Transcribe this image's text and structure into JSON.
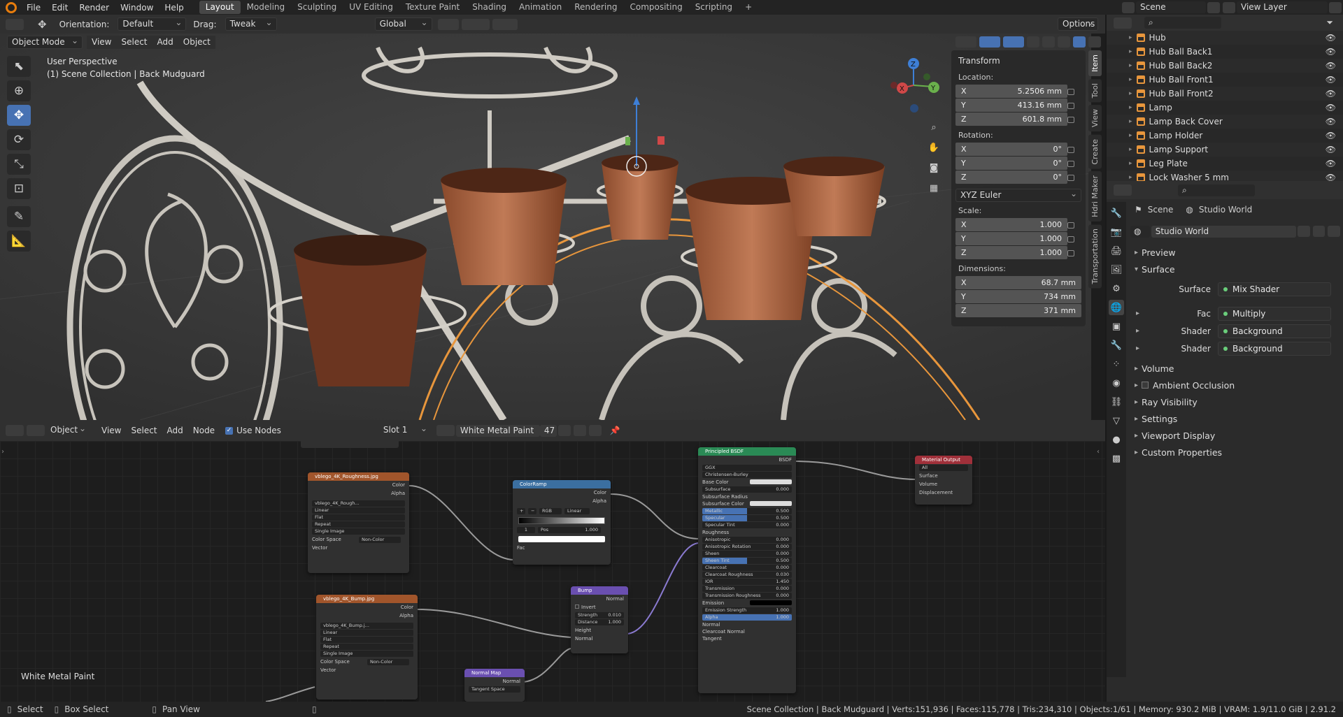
{
  "menubar": {
    "items": [
      "File",
      "Edit",
      "Render",
      "Window",
      "Help"
    ],
    "workspaces": [
      "Layout",
      "Modeling",
      "Sculpting",
      "UV Editing",
      "Texture Paint",
      "Shading",
      "Animation",
      "Rendering",
      "Compositing",
      "Scripting"
    ],
    "active_workspace": "Layout",
    "add_tab": "+",
    "scene": "Scene",
    "view_layer": "View Layer"
  },
  "viewport_header": {
    "orientation_label": "Orientation:",
    "orientation_value": "Default",
    "drag_label": "Drag:",
    "drag_value": "Tweak",
    "transform_orientation": "Global",
    "options": "Options"
  },
  "viewport_header2": {
    "mode": "Object Mode",
    "menus": [
      "View",
      "Select",
      "Add",
      "Object"
    ]
  },
  "viewport": {
    "perspective": "User Perspective",
    "collection": "(1) Scene Collection | Back Mudguard"
  },
  "n_panel": {
    "title": "Transform",
    "location_label": "Location:",
    "location": [
      {
        "axis": "X",
        "value": "5.2506 mm"
      },
      {
        "axis": "Y",
        "value": "413.16 mm"
      },
      {
        "axis": "Z",
        "value": "601.8 mm"
      }
    ],
    "rotation_label": "Rotation:",
    "rotation": [
      {
        "axis": "X",
        "value": "0°"
      },
      {
        "axis": "Y",
        "value": "0°"
      },
      {
        "axis": "Z",
        "value": "0°"
      }
    ],
    "rotation_mode": "XYZ Euler",
    "scale_label": "Scale:",
    "scale": [
      {
        "axis": "X",
        "value": "1.000"
      },
      {
        "axis": "Y",
        "value": "1.000"
      },
      {
        "axis": "Z",
        "value": "1.000"
      }
    ],
    "dimensions_label": "Dimensions:",
    "dimensions": [
      {
        "axis": "X",
        "value": "68.7 mm"
      },
      {
        "axis": "Y",
        "value": "734 mm"
      },
      {
        "axis": "Z",
        "value": "371 mm"
      }
    ],
    "tabs": [
      "Item",
      "Tool",
      "View",
      "Create",
      "Hdri Maker",
      "Transportation"
    ]
  },
  "outliner": {
    "items": [
      "Hub",
      "Hub Ball Back1",
      "Hub Ball Back2",
      "Hub Ball Front1",
      "Hub Ball Front2",
      "Lamp",
      "Lamp Back Cover",
      "Lamp Holder",
      "Lamp Support",
      "Leg Plate",
      "Lock Washer 5 mm"
    ]
  },
  "properties": {
    "breadcrumb_scene": "Scene",
    "breadcrumb_world": "Studio World",
    "world_name": "Studio World",
    "sections": {
      "preview": "Preview",
      "surface": "Surface",
      "volume": "Volume",
      "ao": "Ambient Occlusion",
      "ray": "Ray Visibility",
      "settings": "Settings",
      "viewport_display": "Viewport Display",
      "custom": "Custom Properties"
    },
    "surface_rows": [
      {
        "label": "Surface",
        "value": "Mix Shader"
      },
      {
        "label": "Fac",
        "value": "Multiply"
      },
      {
        "label": "Shader",
        "value": "Background"
      },
      {
        "label": "Shader",
        "value": "Background"
      }
    ]
  },
  "node_header": {
    "type": "Object",
    "menus": [
      "View",
      "Select",
      "Add",
      "Node"
    ],
    "use_nodes": "Use Nodes",
    "slot": "Slot 1",
    "material": "White Metal Paint",
    "users": "47"
  },
  "node_editor": {
    "material_label": "White Metal Paint",
    "nodes": {
      "roughness_tex": {
        "title": "vblego_4K_Roughness.jpg",
        "out1": "Color",
        "out2": "Alpha",
        "image": "vblego_4K_Rough...",
        "interp": "Linear",
        "proj": "Flat",
        "ext": "Repeat",
        "src": "Single Image",
        "cs_label": "Color Space",
        "cs": "Non-Color",
        "vec": "Vector"
      },
      "bump_tex": {
        "title": "vblego_4K_Bump.jpg",
        "out1": "Color",
        "out2": "Alpha",
        "image": "vblego_4K_Bump.j...",
        "interp": "Linear",
        "proj": "Flat",
        "ext": "Repeat",
        "src": "Single Image",
        "cs_label": "Color Space",
        "cs": "Non-Color",
        "vec": "Vector"
      },
      "colorramp": {
        "title": "ColorRamp",
        "out1": "Color",
        "out2": "Alpha",
        "mode": "RGB",
        "interp": "Linear",
        "stop": "1",
        "pos_label": "Pos",
        "pos": "1.000",
        "fac": "Fac"
      },
      "bump": {
        "title": "Bump",
        "out": "Normal",
        "invert": "Invert",
        "strength_label": "Strength",
        "strength": "0.010",
        "distance_label": "Distance",
        "distance": "1.000",
        "height": "Height",
        "normal": "Normal"
      },
      "normalmap": {
        "title": "Normal Map",
        "out": "Normal",
        "space": "Tangent Space"
      },
      "bsdf": {
        "title": "Principled BSDF",
        "out": "BSDF",
        "dist": "GGX",
        "sss": "Christensen-Burley",
        "rows": [
          {
            "l": "Base Color",
            "v": ""
          },
          {
            "l": "Subsurface",
            "v": "0.000"
          },
          {
            "l": "Subsurface Radius",
            "v": ""
          },
          {
            "l": "Subsurface Color",
            "v": ""
          },
          {
            "l": "Metallic",
            "v": "0.500"
          },
          {
            "l": "Specular",
            "v": "0.500"
          },
          {
            "l": "Specular Tint",
            "v": "0.000"
          },
          {
            "l": "Roughness",
            "v": ""
          },
          {
            "l": "Anisotropic",
            "v": "0.000"
          },
          {
            "l": "Anisotropic Rotation",
            "v": "0.000"
          },
          {
            "l": "Sheen",
            "v": "0.000"
          },
          {
            "l": "Sheen Tint",
            "v": "0.500"
          },
          {
            "l": "Clearcoat",
            "v": "0.000"
          },
          {
            "l": "Clearcoat Roughness",
            "v": "0.030"
          },
          {
            "l": "IOR",
            "v": "1.450"
          },
          {
            "l": "Transmission",
            "v": "0.000"
          },
          {
            "l": "Transmission Roughness",
            "v": "0.000"
          },
          {
            "l": "Emission",
            "v": ""
          },
          {
            "l": "Emission Strength",
            "v": "1.000"
          },
          {
            "l": "Alpha",
            "v": "1.000"
          },
          {
            "l": "Normal",
            "v": ""
          },
          {
            "l": "Clearcoat Normal",
            "v": ""
          },
          {
            "l": "Tangent",
            "v": ""
          }
        ]
      },
      "output": {
        "title": "Material Output",
        "target": "All",
        "surface": "Surface",
        "volume": "Volume",
        "displacement": "Displacement"
      }
    }
  },
  "statusbar": {
    "select": "Select",
    "box_select": "Box Select",
    "pan_view": "Pan View",
    "stats": "Scene Collection | Back Mudguard | Verts:151,936 | Faces:115,778 | Tris:234,310 | Objects:1/61 | Memory: 930.2 MiB | VRAM: 1.9/11.0 GiB | 2.91.2"
  },
  "colors": {
    "accent": "#4772b3",
    "selected_outline": "#e8963c",
    "texture_header": "#a1552b",
    "colorramp_header": "#3b6fa0",
    "bump_header": "#6a4fb0",
    "bsdf_header": "#2a8a55",
    "output_header": "#a0303a"
  }
}
